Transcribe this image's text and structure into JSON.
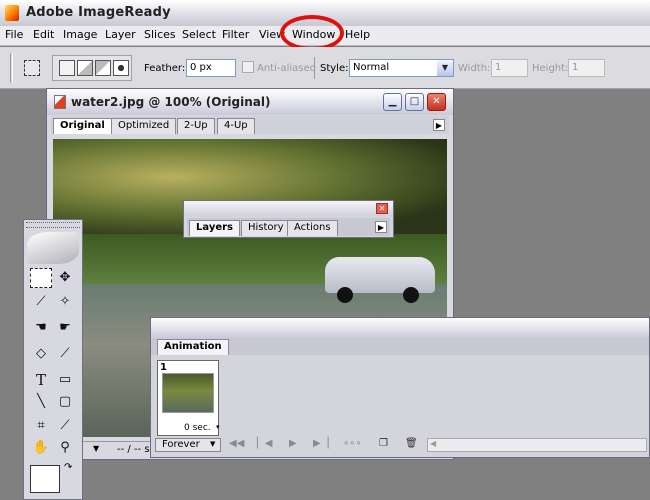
{
  "app": {
    "title": "Adobe ImageReady"
  },
  "menu": {
    "items": [
      "File",
      "Edit",
      "Image",
      "Layer",
      "Slices",
      "Select",
      "Filter",
      "View",
      "Window",
      "Help"
    ]
  },
  "options": {
    "feather_label": "Feather:",
    "feather_value": "0 px",
    "antialiased_label": "Anti-aliased",
    "style_label": "Style:",
    "style_value": "Normal",
    "width_label": "Width:",
    "width_value": "1",
    "height_label": "Height:",
    "height_value": "1"
  },
  "document": {
    "title": "water2.jpg @ 100% (Original)",
    "tabs": [
      "Original",
      "Optimized",
      "2-Up",
      "4-Up"
    ],
    "status": "-- / -- s"
  },
  "layers_palette": {
    "tabs": [
      "Layers",
      "History",
      "Actions"
    ]
  },
  "animation": {
    "tab": "Animation",
    "frame_number": "1",
    "frame_delay": "0 sec.",
    "loop": "Forever"
  },
  "colors": {
    "callout": "#e01010",
    "title_active": "#dadae6",
    "close_button": "#c83020"
  }
}
